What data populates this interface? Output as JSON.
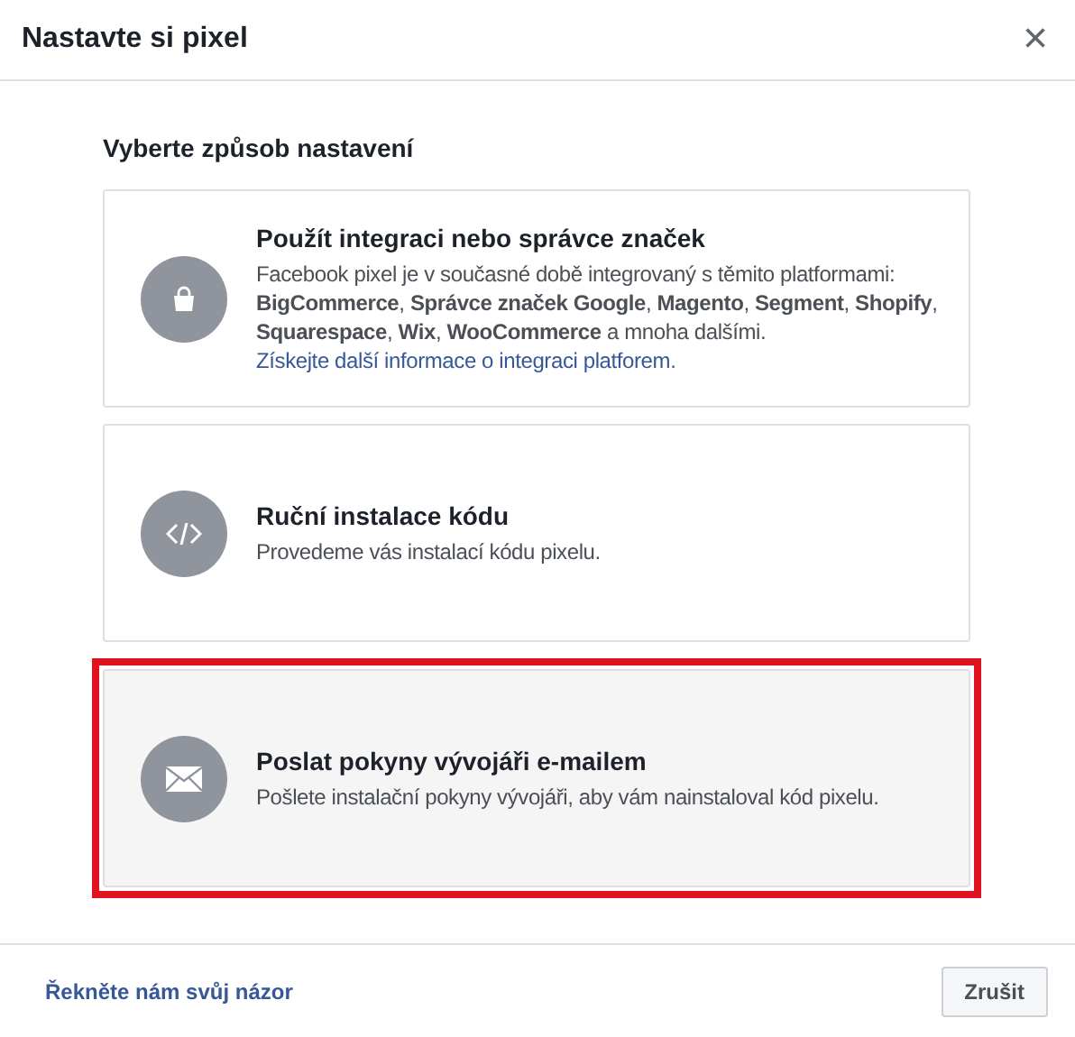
{
  "dialog": {
    "title": "Nastavte si pixel",
    "close": "×"
  },
  "heading": "Vyberte způsob nastavení",
  "options": [
    {
      "kind": "integration",
      "title": "Použít integraci nebo správce značek",
      "description": "Facebook pixel je v současné době integrovaný s těmito platformami: **BigCommerce**, **Správce značek Google**, **Magento**, **Segment**, **Shopify**, **Squarespace**, **Wix**, **WooCommerce** a mnoha dalšími.",
      "link": "Získejte další informace o integraci platforem.",
      "highlighted": false
    },
    {
      "kind": "code",
      "title": "Ruční instalace kódu",
      "description": "Provedeme vás instalací kódu pixelu.",
      "highlighted": false
    },
    {
      "kind": "email",
      "title": "Poslat pokyny vývojáři e-mailem",
      "description": "Pošlete instalační pokyny vývojáři, aby vám nainstaloval kód pixelu.",
      "highlighted": true
    }
  ],
  "footer": {
    "feedback_link": "Řekněte nám svůj názor",
    "cancel_button": "Zrušit"
  }
}
